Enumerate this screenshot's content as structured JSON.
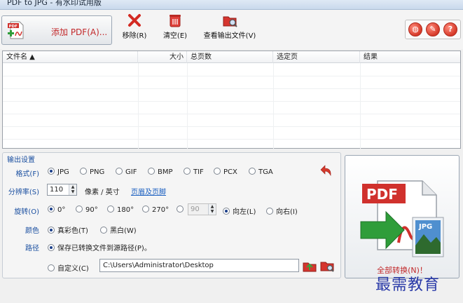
{
  "window": {
    "title": "PDF to JPG - 有水印试用版"
  },
  "toolbar": {
    "add_label": "添加 PDF(A)...",
    "remove_label": "移除(R)",
    "clear_label": "清空(E)",
    "view_output_label": "查看输出文件(V)"
  },
  "file_list": {
    "columns": [
      "文件名 ▲",
      "大小",
      "总页数",
      "选定页",
      "结果"
    ]
  },
  "settings": {
    "group_title": "输出设置",
    "format_label": "格式(F)",
    "formats": [
      "JPG",
      "PNG",
      "GIF",
      "BMP",
      "TIF",
      "PCX",
      "TGA"
    ],
    "selected_format": "JPG",
    "resolution_label": "分辨率(S)",
    "resolution_value": "110",
    "resolution_unit": "像素 / 英寸",
    "header_footer_link": "页眉及页脚",
    "rotation_label": "旋转(O)",
    "rotations": [
      "0°",
      "90°",
      "180°",
      "270°"
    ],
    "custom_angle": "90",
    "rotate_left": "向左(L)",
    "rotate_right": "向右(I)",
    "color_label": "颜色",
    "color_options": [
      "真彩色(T)",
      "黑白(W)"
    ],
    "path_label": "路径",
    "path_same": "保存已转换文件到源路径(P)。",
    "path_custom": "自定义(C)",
    "path_value": "C:\\Users\\Administrator\\Desktop"
  },
  "convert": {
    "label": "全部转换(N)！"
  },
  "watermark": {
    "text": "最需教育"
  },
  "colors": {
    "accent_red": "#c2282a",
    "label_blue": "#1a4fa0",
    "link_blue": "#1a5fc0"
  }
}
